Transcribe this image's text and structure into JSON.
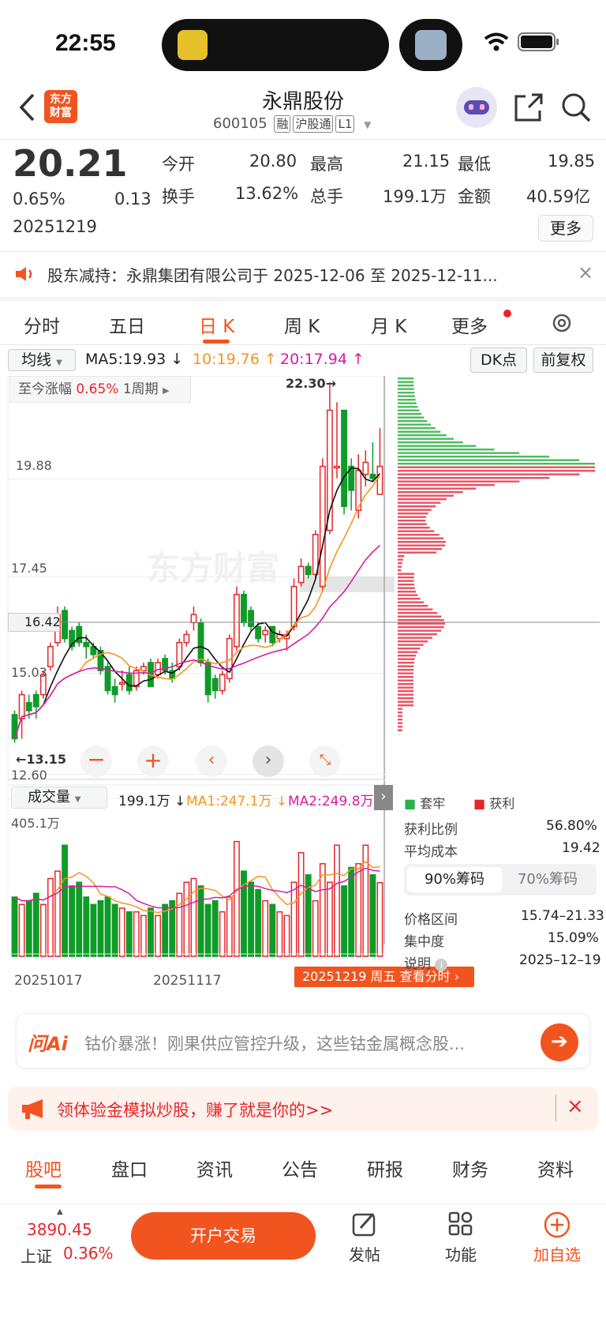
{
  "status": {
    "time": "22:55"
  },
  "header": {
    "logo_line1": "东方",
    "logo_line2": "财富",
    "stock_name": "永鼎股份",
    "code": "600105",
    "tags": [
      "融",
      "沪股通",
      "L1"
    ]
  },
  "quote": {
    "price": "20.21",
    "pct": "0.65%",
    "change": "0.13",
    "date": "20251219",
    "open_label": "今开",
    "open": "20.80",
    "high_label": "最高",
    "high": "21.15",
    "low_label": "最低",
    "low": "19.85",
    "turnover_label": "换手",
    "turnover": "13.62%",
    "volume_label": "总手",
    "volume": "199.1万",
    "amount_label": "金额",
    "amount": "40.59亿",
    "more": "更多"
  },
  "notice": {
    "text": "股东减持：永鼎集团有限公司于 2025-12-06 至 2025-12-11..."
  },
  "period_tabs": [
    "分时",
    "五日",
    "日 K",
    "周 K",
    "月 K",
    "更多"
  ],
  "active_tab": 2,
  "indicator": {
    "name": "均线",
    "ma5": "MA5:19.93 ↓",
    "ma10": "10:19.76 ↑",
    "ma20": "20:17.94 ↑",
    "dk": "DK点",
    "adjust": "前复权"
  },
  "kline": {
    "range_label": "至今涨幅",
    "range_val": "0.65%",
    "period": "1周期",
    "max_label": "22.30→",
    "min_label": "←13.15",
    "y_labels": [
      "19.88",
      "17.45",
      "16.42",
      "15.03",
      "12.60"
    ],
    "watermark": "东方财富"
  },
  "volume_panel": {
    "name": "成交量",
    "vol": "199.1万 ↓",
    "ma1": "MA1:247.1万 ↓",
    "ma2": "MA2:249.8万 ↑",
    "max": "405.1万",
    "dates": [
      "20251017",
      "20251117"
    ],
    "cursor_label": "20251219 周五 查看分时"
  },
  "chips": {
    "legend_trapped": "套牢",
    "legend_profit": "获利",
    "profit_ratio_label": "获利比例",
    "profit_ratio": "56.80%",
    "avg_cost_label": "平均成本",
    "avg_cost": "19.42",
    "tab1": "90%筹码",
    "tab2": "70%筹码",
    "range_label": "价格区间",
    "range": "15.74–21.33",
    "conc_label": "集中度",
    "conc": "15.09%",
    "note_label": "说明",
    "note_date": "2025–12–19"
  },
  "ai": {
    "brand": "问Ai",
    "text": "钴价暴涨！刚果供应管控升级，这些钴金属概念股..."
  },
  "promo": {
    "text": "领体验金模拟炒股，赚了就是你的>>"
  },
  "bottom_tabs": [
    "股吧",
    "盘口",
    "资讯",
    "公告",
    "研报",
    "财务",
    "资料"
  ],
  "footer": {
    "index_val": "3890.45",
    "index_name": "上证",
    "index_pct": "0.36%",
    "trade": "开户交易",
    "post": "发帖",
    "func": "功能",
    "add": "加自选"
  },
  "colors": {
    "up": "#e7262a",
    "down": "#0f9b28",
    "brand": "#f2541f"
  },
  "chart_data": {
    "type": "candlestick",
    "open": [
      14.0,
      13.9,
      14.3,
      14.5,
      14.5,
      15.2,
      15.8,
      16.6,
      16.1,
      16.2,
      15.8,
      15.7,
      15.6,
      15.2,
      14.7,
      14.8,
      15.0,
      14.7,
      15.1,
      15.3,
      15.0,
      15.4,
      15.1,
      15.2,
      15.8,
      16.3,
      16.3,
      15.3,
      14.9,
      14.6,
      14.9,
      15.7,
      17.0,
      16.6,
      16.2,
      16.0,
      16.2,
      15.9,
      15.9,
      16.2,
      17.3,
      17.7,
      17.5,
      17.2,
      18.6,
      20.2,
      21.6,
      20.2,
      19.1,
      20.0,
      20.0,
      19.5
    ],
    "close": [
      13.4,
      14.5,
      14.1,
      14.2,
      15.0,
      15.7,
      16.5,
      15.9,
      15.7,
      15.8,
      15.7,
      15.5,
      15.1,
      14.6,
      14.5,
      14.8,
      14.6,
      15.1,
      15.2,
      14.7,
      15.3,
      15.1,
      14.9,
      15.8,
      16.0,
      16.5,
      15.3,
      14.5,
      14.6,
      15.0,
      15.9,
      17.0,
      16.3,
      16.2,
      15.9,
      16.1,
      15.8,
      16.0,
      16.0,
      17.2,
      17.7,
      17.5,
      18.5,
      20.2,
      21.6,
      20.2,
      19.2,
      19.6,
      20.1,
      20.3,
      19.9,
      20.2
    ],
    "high": [
      14.1,
      14.6,
      14.5,
      14.6,
      15.1,
      15.8,
      16.7,
      16.7,
      16.2,
      16.3,
      16.0,
      15.8,
      15.7,
      15.3,
      14.9,
      15.1,
      15.2,
      15.2,
      15.3,
      15.4,
      15.4,
      15.5,
      15.3,
      15.9,
      16.1,
      16.7,
      16.4,
      15.4,
      15.0,
      15.1,
      16.0,
      17.2,
      17.1,
      16.7,
      16.3,
      16.2,
      16.2,
      16.1,
      16.1,
      17.4,
      17.9,
      17.8,
      18.6,
      20.4,
      22.3,
      21.8,
      21.2,
      20.4,
      20.5,
      20.6,
      20.8,
      21.15
    ],
    "low": [
      13.3,
      13.4,
      13.9,
      13.9,
      14.4,
      15.1,
      15.7,
      15.8,
      15.6,
      15.7,
      15.4,
      15.4,
      15.0,
      14.5,
      14.3,
      14.6,
      14.5,
      14.6,
      15.0,
      14.7,
      14.9,
      15.0,
      14.8,
      15.1,
      15.7,
      16.1,
      15.2,
      14.3,
      14.4,
      14.5,
      14.8,
      15.6,
      16.2,
      16.1,
      15.8,
      15.8,
      15.7,
      15.8,
      15.6,
      16.1,
      17.2,
      17.4,
      17.4,
      17.1,
      18.5,
      19.9,
      19.0,
      19.1,
      18.9,
      19.7,
      19.8,
      19.85
    ],
    "volume": [
      160,
      140,
      150,
      170,
      140,
      210,
      230,
      300,
      190,
      200,
      160,
      140,
      150,
      160,
      140,
      130,
      120,
      120,
      110,
      130,
      110,
      140,
      150,
      170,
      200,
      210,
      190,
      140,
      150,
      120,
      160,
      310,
      230,
      200,
      180,
      150,
      140,
      120,
      110,
      200,
      280,
      220,
      150,
      250,
      200,
      300,
      190,
      240,
      250,
      300,
      220,
      199
    ],
    "ma_series": [
      "MA5",
      "MA10",
      "MA20"
    ],
    "y_range": [
      12.6,
      22.3
    ],
    "volume_max": 405.1
  }
}
